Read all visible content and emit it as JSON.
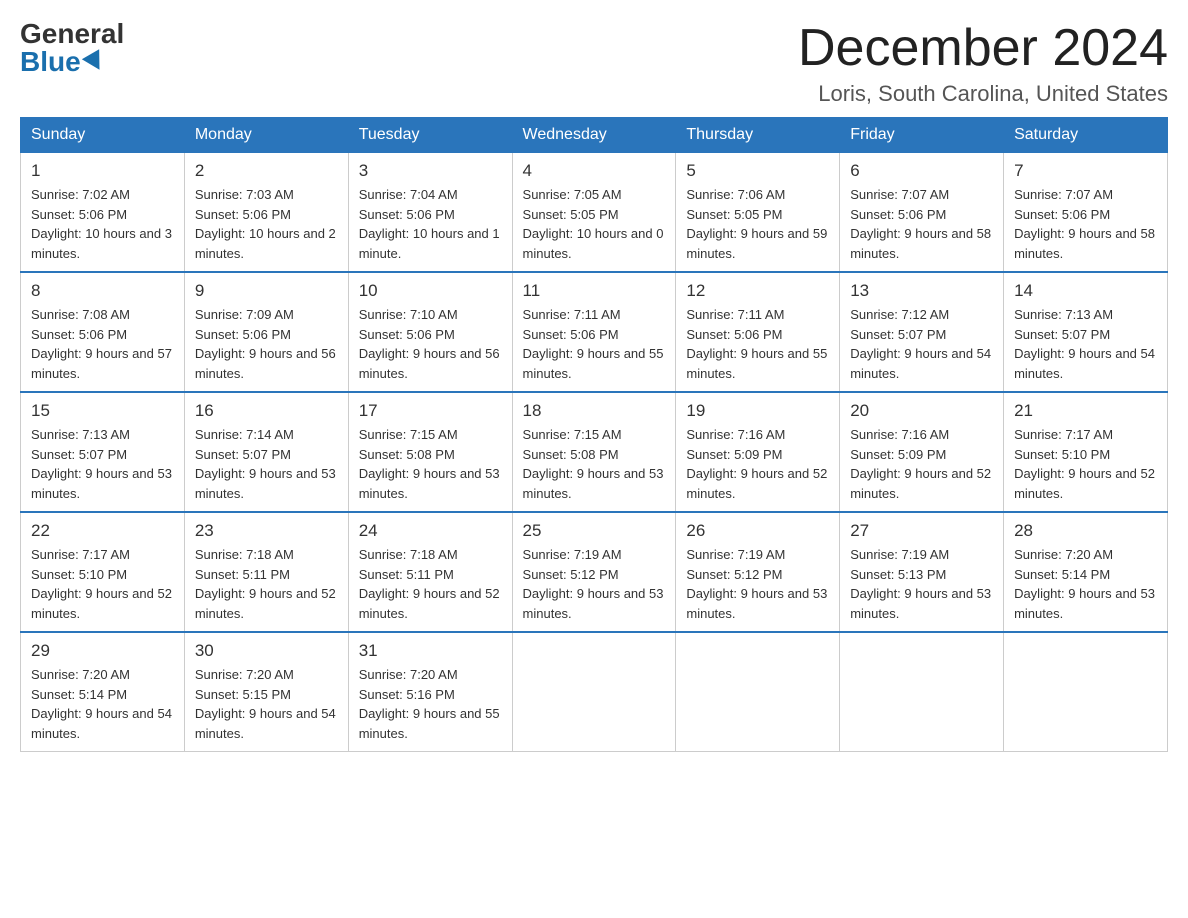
{
  "logo": {
    "general": "General",
    "blue": "Blue"
  },
  "title": "December 2024",
  "location": "Loris, South Carolina, United States",
  "days_of_week": [
    "Sunday",
    "Monday",
    "Tuesday",
    "Wednesday",
    "Thursday",
    "Friday",
    "Saturday"
  ],
  "weeks": [
    [
      {
        "num": "1",
        "sunrise": "7:02 AM",
        "sunset": "5:06 PM",
        "daylight": "10 hours and 3 minutes."
      },
      {
        "num": "2",
        "sunrise": "7:03 AM",
        "sunset": "5:06 PM",
        "daylight": "10 hours and 2 minutes."
      },
      {
        "num": "3",
        "sunrise": "7:04 AM",
        "sunset": "5:06 PM",
        "daylight": "10 hours and 1 minute."
      },
      {
        "num": "4",
        "sunrise": "7:05 AM",
        "sunset": "5:05 PM",
        "daylight": "10 hours and 0 minutes."
      },
      {
        "num": "5",
        "sunrise": "7:06 AM",
        "sunset": "5:05 PM",
        "daylight": "9 hours and 59 minutes."
      },
      {
        "num": "6",
        "sunrise": "7:07 AM",
        "sunset": "5:06 PM",
        "daylight": "9 hours and 58 minutes."
      },
      {
        "num": "7",
        "sunrise": "7:07 AM",
        "sunset": "5:06 PM",
        "daylight": "9 hours and 58 minutes."
      }
    ],
    [
      {
        "num": "8",
        "sunrise": "7:08 AM",
        "sunset": "5:06 PM",
        "daylight": "9 hours and 57 minutes."
      },
      {
        "num": "9",
        "sunrise": "7:09 AM",
        "sunset": "5:06 PM",
        "daylight": "9 hours and 56 minutes."
      },
      {
        "num": "10",
        "sunrise": "7:10 AM",
        "sunset": "5:06 PM",
        "daylight": "9 hours and 56 minutes."
      },
      {
        "num": "11",
        "sunrise": "7:11 AM",
        "sunset": "5:06 PM",
        "daylight": "9 hours and 55 minutes."
      },
      {
        "num": "12",
        "sunrise": "7:11 AM",
        "sunset": "5:06 PM",
        "daylight": "9 hours and 55 minutes."
      },
      {
        "num": "13",
        "sunrise": "7:12 AM",
        "sunset": "5:07 PM",
        "daylight": "9 hours and 54 minutes."
      },
      {
        "num": "14",
        "sunrise": "7:13 AM",
        "sunset": "5:07 PM",
        "daylight": "9 hours and 54 minutes."
      }
    ],
    [
      {
        "num": "15",
        "sunrise": "7:13 AM",
        "sunset": "5:07 PM",
        "daylight": "9 hours and 53 minutes."
      },
      {
        "num": "16",
        "sunrise": "7:14 AM",
        "sunset": "5:07 PM",
        "daylight": "9 hours and 53 minutes."
      },
      {
        "num": "17",
        "sunrise": "7:15 AM",
        "sunset": "5:08 PM",
        "daylight": "9 hours and 53 minutes."
      },
      {
        "num": "18",
        "sunrise": "7:15 AM",
        "sunset": "5:08 PM",
        "daylight": "9 hours and 53 minutes."
      },
      {
        "num": "19",
        "sunrise": "7:16 AM",
        "sunset": "5:09 PM",
        "daylight": "9 hours and 52 minutes."
      },
      {
        "num": "20",
        "sunrise": "7:16 AM",
        "sunset": "5:09 PM",
        "daylight": "9 hours and 52 minutes."
      },
      {
        "num": "21",
        "sunrise": "7:17 AM",
        "sunset": "5:10 PM",
        "daylight": "9 hours and 52 minutes."
      }
    ],
    [
      {
        "num": "22",
        "sunrise": "7:17 AM",
        "sunset": "5:10 PM",
        "daylight": "9 hours and 52 minutes."
      },
      {
        "num": "23",
        "sunrise": "7:18 AM",
        "sunset": "5:11 PM",
        "daylight": "9 hours and 52 minutes."
      },
      {
        "num": "24",
        "sunrise": "7:18 AM",
        "sunset": "5:11 PM",
        "daylight": "9 hours and 52 minutes."
      },
      {
        "num": "25",
        "sunrise": "7:19 AM",
        "sunset": "5:12 PM",
        "daylight": "9 hours and 53 minutes."
      },
      {
        "num": "26",
        "sunrise": "7:19 AM",
        "sunset": "5:12 PM",
        "daylight": "9 hours and 53 minutes."
      },
      {
        "num": "27",
        "sunrise": "7:19 AM",
        "sunset": "5:13 PM",
        "daylight": "9 hours and 53 minutes."
      },
      {
        "num": "28",
        "sunrise": "7:20 AM",
        "sunset": "5:14 PM",
        "daylight": "9 hours and 53 minutes."
      }
    ],
    [
      {
        "num": "29",
        "sunrise": "7:20 AM",
        "sunset": "5:14 PM",
        "daylight": "9 hours and 54 minutes."
      },
      {
        "num": "30",
        "sunrise": "7:20 AM",
        "sunset": "5:15 PM",
        "daylight": "9 hours and 54 minutes."
      },
      {
        "num": "31",
        "sunrise": "7:20 AM",
        "sunset": "5:16 PM",
        "daylight": "9 hours and 55 minutes."
      },
      null,
      null,
      null,
      null
    ]
  ]
}
